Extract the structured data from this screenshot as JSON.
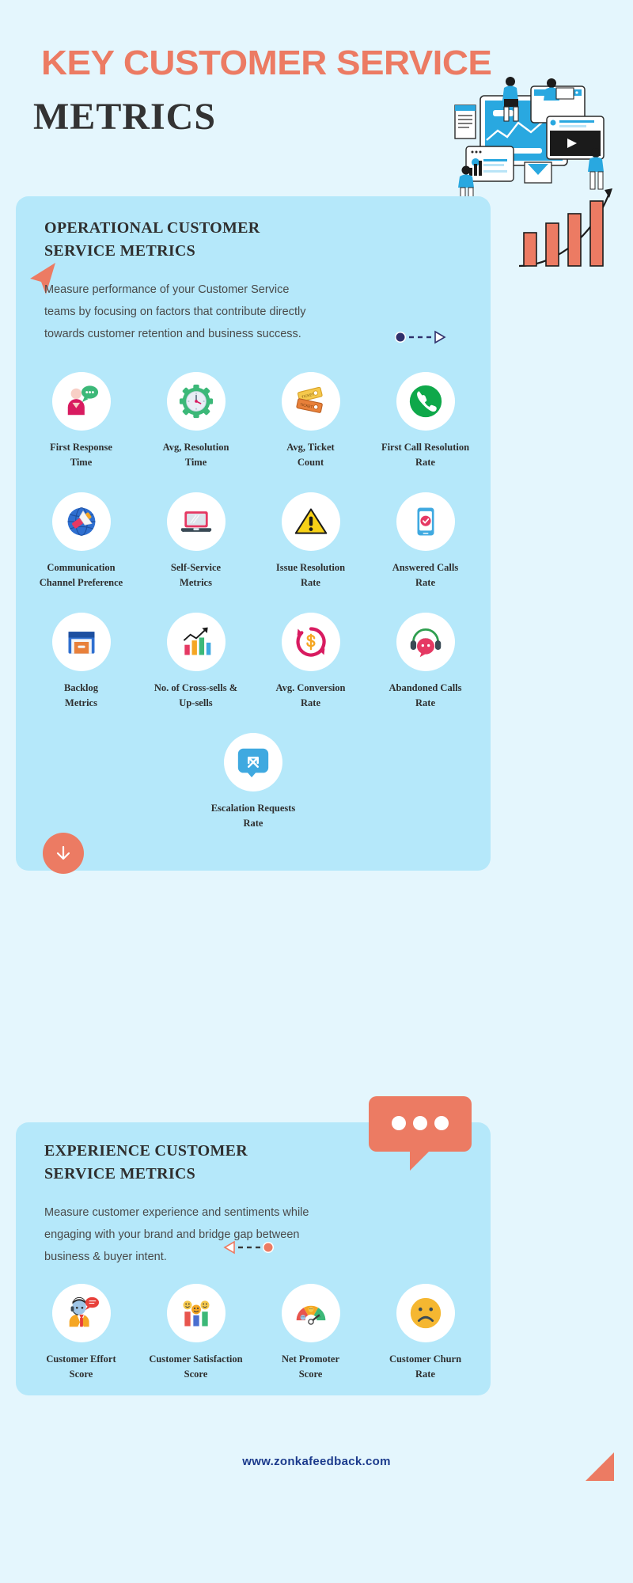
{
  "header": {
    "title_line1": "KEY CUSTOMER SERVICE",
    "title_line2": "METRICS"
  },
  "colors": {
    "page_bg": "#e4f6fd",
    "card_bg": "#b5e8fa",
    "accent_coral": "#ec7b63",
    "heading_dark": "#2f2f2f",
    "footer_navy": "#1b3a8c"
  },
  "sections": [
    {
      "id": "operational",
      "title": "OPERATIONAL CUSTOMER\nSERVICE METRICS",
      "description": "Measure performance of your Customer Service\nteams by focusing on factors that contribute directly\ntowards customer retention and business success.",
      "metrics": [
        {
          "label": "First Response\nTime",
          "icon": "person-chat-icon"
        },
        {
          "label": "Avg, Resolution\nTime",
          "icon": "clock-gear-icon"
        },
        {
          "label": "Avg, Ticket\nCount",
          "icon": "tickets-icon"
        },
        {
          "label": "First Call Resolution\nRate",
          "icon": "phone-call-icon"
        },
        {
          "label": "Communication\nChannel Preference",
          "icon": "globe-megaphone-icon"
        },
        {
          "label": "Self-Service\nMetrics",
          "icon": "laptop-icon"
        },
        {
          "label": "Issue Resolution\nRate",
          "icon": "warning-triangle-icon"
        },
        {
          "label": "Answered Calls\nRate",
          "icon": "mobile-check-icon"
        },
        {
          "label": "Backlog\nMetrics",
          "icon": "archive-box-icon"
        },
        {
          "label": "No. of Cross-sells &\nUp-sells",
          "icon": "bar-growth-icon"
        },
        {
          "label": "Avg. Conversion\nRate",
          "icon": "currency-refresh-icon"
        },
        {
          "label": "Abandoned Calls\nRate",
          "icon": "headset-chat-icon"
        },
        {
          "label": "Escalation Requests\nRate",
          "icon": "escalation-arrows-icon"
        }
      ]
    },
    {
      "id": "experience",
      "title": "EXPERIENCE CUSTOMER\nSERVICE METRICS",
      "description": "Measure customer experience and sentiments while\nengaging with your brand and bridge gap between\nbusiness & buyer intent.",
      "metrics": [
        {
          "label": "Customer Effort\nScore",
          "icon": "agent-headset-icon"
        },
        {
          "label": "Customer Satisfaction\nScore",
          "icon": "smiley-bars-icon"
        },
        {
          "label": "Net Promoter\nScore",
          "icon": "gauge-icon"
        },
        {
          "label": "Customer Churn\nRate",
          "icon": "sad-face-icon"
        }
      ]
    }
  ],
  "decor": {
    "scroll_down_icon": "arrow-down-icon",
    "pointer_marker_icon": "triangle-pointer-icon",
    "dashed_arrow_right_icon": "dashed-arrow-right-icon",
    "dashed_arrow_left_icon": "dashed-arrow-left-icon",
    "speech_bubble_icon": "speech-bubble-icon",
    "growth_chart_icon": "growth-bar-chart-icon",
    "hero_illustration_icon": "dashboard-team-illustration-icon",
    "corner_triangle_icon": "corner-triangle-icon"
  },
  "footer": {
    "url": "www.zonkafeedback.com"
  }
}
